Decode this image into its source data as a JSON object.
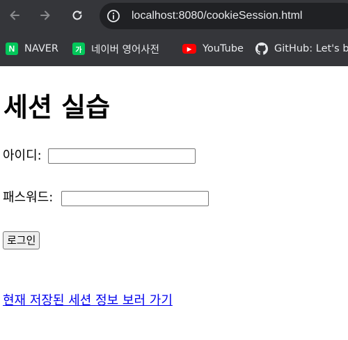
{
  "browser": {
    "url": "localhost:8080/cookieSession.html",
    "bookmarks": [
      {
        "label": "NAVER",
        "icon": "naver-icon",
        "color": "#03c75a",
        "glyph": "N"
      },
      {
        "label": "네이버 영어사전",
        "icon": "naver-dictionary-icon",
        "color": "#03c75a",
        "glyph": "가"
      },
      {
        "label": "YouTube",
        "icon": "youtube-icon",
        "color": "#ff0000",
        "glyph": "▶"
      },
      {
        "label": "GitHub: Let's bu",
        "icon": "github-icon",
        "color": "#ffffff",
        "glyph": ""
      }
    ]
  },
  "page": {
    "title": "세션 실습",
    "id_label": "아이디:",
    "password_label": "패스워드:",
    "login_button": "로그인",
    "session_link": "현재 저장된 세션 정보 보러 가기"
  }
}
